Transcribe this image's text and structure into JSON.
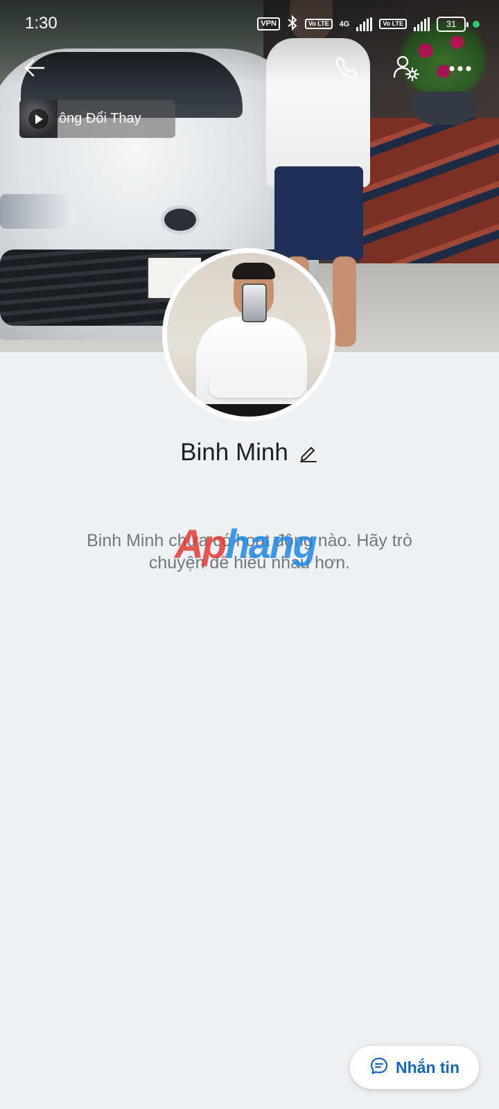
{
  "status_bar": {
    "time": "1:30",
    "vpn": "VPN",
    "volte1": "Vo LTE",
    "network": "4G",
    "volte2": "Vo LTE",
    "battery": "31",
    "dot_color": "#2ecc71"
  },
  "nav": {
    "back_icon": "arrow-left-icon",
    "call_icon": "phone-icon",
    "settings_icon": "user-gear-icon",
    "more_icon": "more-horizontal-icon"
  },
  "music": {
    "title": "ông Đổi Thay",
    "icon": "play-icon"
  },
  "profile": {
    "name": "Binh Minh",
    "edit_icon": "pencil-icon"
  },
  "empty_state": {
    "text": "Binh Minh chưa có hoạt động nào. Hãy trò chuyện để hiểu nhau hơn."
  },
  "watermark": {
    "part1": "Ap",
    "part2": "hang"
  },
  "action": {
    "message_label": "Nhắn tin",
    "icon": "chat-bubble-icon",
    "accent": "#1565c0"
  }
}
